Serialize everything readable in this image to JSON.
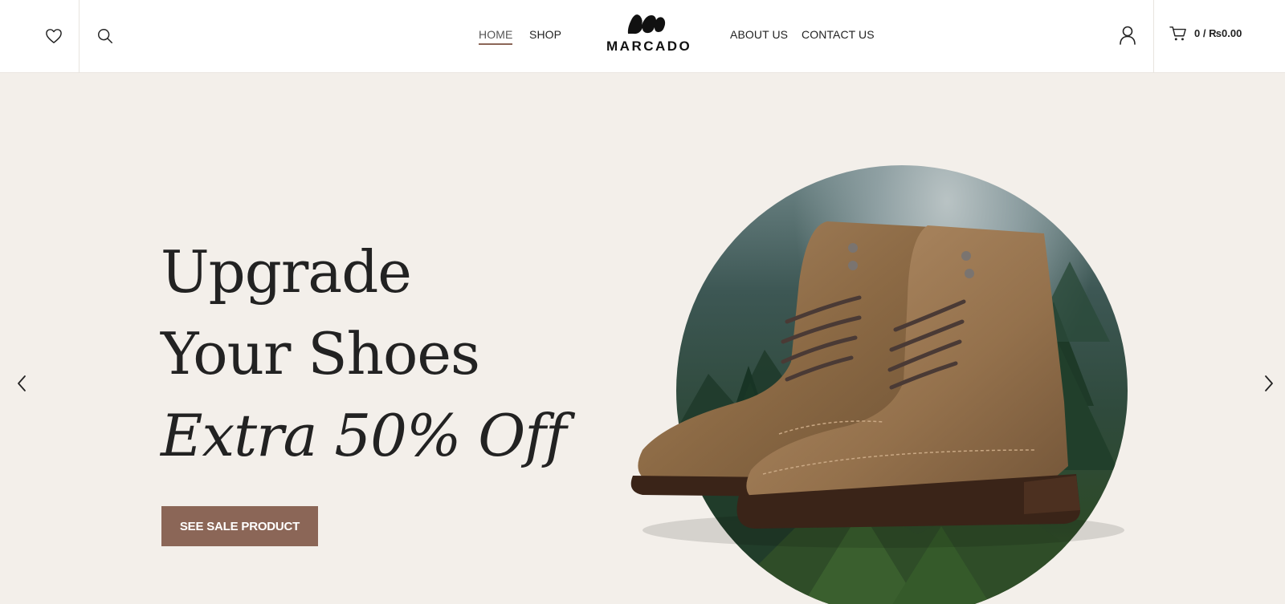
{
  "header": {
    "nav_left": [
      {
        "label": "HOME",
        "active": true
      },
      {
        "label": "SHOP",
        "active": false
      }
    ],
    "nav_right": [
      {
        "label": "ABOUT US"
      },
      {
        "label": "CONTACT US"
      }
    ],
    "logo_text": "MARCADO",
    "cart_summary": "0 / ₨0.00",
    "icons": {
      "wishlist": "heart-icon",
      "search": "search-icon",
      "account": "user-icon",
      "cart": "cart-icon"
    }
  },
  "hero": {
    "line1": "Upgrade",
    "line2": "Your Shoes",
    "line3": "Extra 50% Off",
    "cta_label": "SEE SALE PRODUCT",
    "prev_icon": "chevron-left-icon",
    "next_icon": "chevron-right-icon",
    "image": "brown-leather-boots-on-forest-circle"
  },
  "colors": {
    "background": "#f3efea",
    "accent": "#8b6657",
    "text": "#222222"
  }
}
